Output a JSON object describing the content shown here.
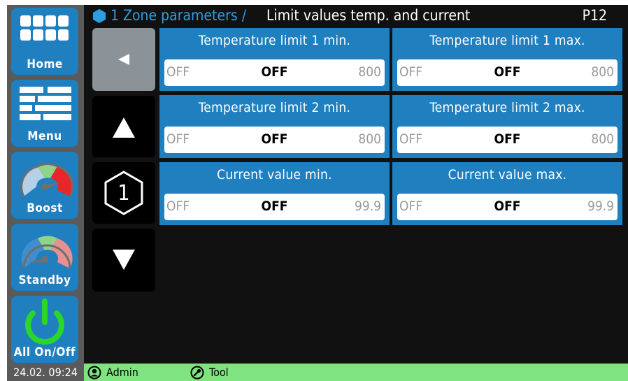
{
  "header": {
    "breadcrumb": "1 Zone parameters /",
    "title": "Limit values temp. and current",
    "page_code": "P12"
  },
  "sidebar": {
    "items": [
      {
        "label": "Home",
        "icon": "home-grid-icon"
      },
      {
        "label": "Menu",
        "icon": "menu-lines-icon"
      },
      {
        "label": "Boost",
        "icon": "boost-gauge-icon"
      },
      {
        "label": "Standby",
        "icon": "standby-gauge-icon"
      },
      {
        "label": "All On/Off",
        "icon": "power-icon"
      }
    ]
  },
  "nav": {
    "back_icon": "back-arrow-icon",
    "up_icon": "up-arrow-icon",
    "zone_number": "1",
    "down_icon": "down-arrow-icon"
  },
  "params": [
    {
      "title": "Temperature limit 1 min.",
      "min": "OFF",
      "value": "OFF",
      "max": "800"
    },
    {
      "title": "Temperature limit 1 max.",
      "min": "OFF",
      "value": "OFF",
      "max": "800"
    },
    {
      "title": "Temperature limit 2 min.",
      "min": "OFF",
      "value": "OFF",
      "max": "800"
    },
    {
      "title": "Temperature limit 2 max.",
      "min": "OFF",
      "value": "OFF",
      "max": "800"
    },
    {
      "title": "Current value min.",
      "min": "OFF",
      "value": "OFF",
      "max": "99.9"
    },
    {
      "title": "Current value max.",
      "min": "OFF",
      "value": "OFF",
      "max": "99.9"
    }
  ],
  "status": {
    "datetime": "24.02. 09:24",
    "user": "Admin",
    "mode": "Tool",
    "bar_color": "#7fe37f"
  },
  "colors": {
    "accent": "#1f7fbf",
    "breadcrumb": "#2f9ee0",
    "background": "#111111"
  }
}
